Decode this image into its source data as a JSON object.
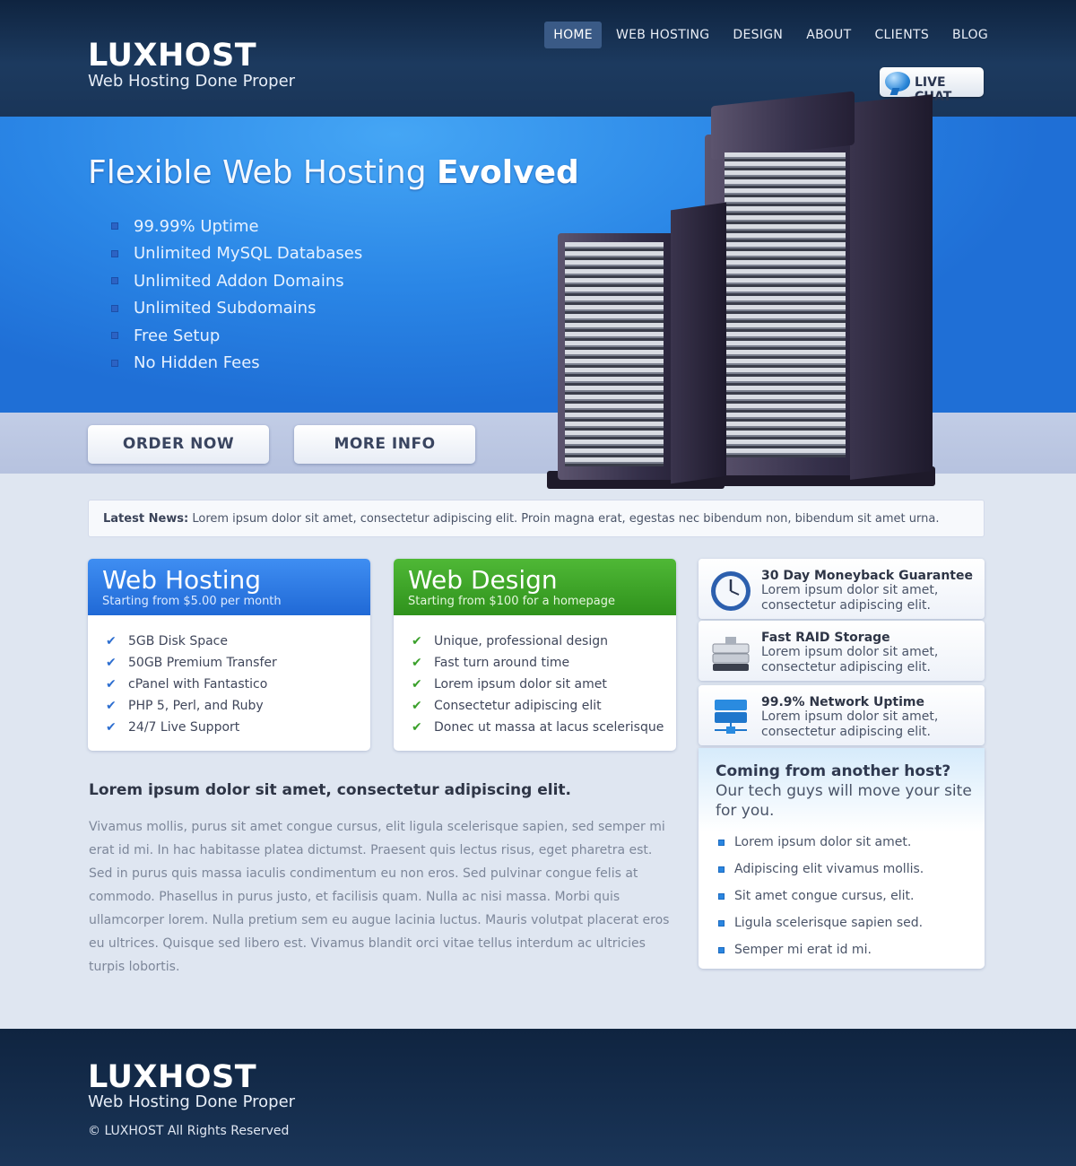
{
  "brand": {
    "name": "LUXHOST",
    "tagline": "Web Hosting Done Proper"
  },
  "nav": {
    "items": [
      "HOME",
      "WEB HOSTING",
      "DESIGN",
      "ABOUT",
      "CLIENTS",
      "BLOG"
    ],
    "active": "HOME"
  },
  "live_chat": {
    "label": "LIVE CHAT",
    "icon": "chat-bubble-icon"
  },
  "hero": {
    "title_plain": "Flexible Web Hosting",
    "title_bold": "Evolved",
    "features": [
      "99.99% Uptime",
      "Unlimited MySQL Databases",
      "Unlimited Addon Domains",
      "Unlimited Subdomains",
      "Free Setup",
      "No Hidden Fees"
    ],
    "order_label": "ORDER NOW",
    "more_label": "MORE INFO"
  },
  "news": {
    "label": "Latest News:",
    "text": "Lorem ipsum dolor sit amet, consectetur adipiscing elit. Proin magna erat, egestas nec bibendum non, bibendum sit amet urna."
  },
  "cards": {
    "hosting": {
      "title": "Web Hosting",
      "subtitle": "Starting from $5.00 per month",
      "items": [
        "5GB Disk Space",
        "50GB Premium Transfer",
        "cPanel with Fantastico",
        "PHP 5, Perl, and Ruby",
        "24/7 Live Support"
      ]
    },
    "design": {
      "title": "Web Design",
      "subtitle": "Starting from $100 for a homepage",
      "items": [
        "Unique, professional design",
        "Fast turn around time",
        "Lorem ipsum dolor sit amet",
        "Consectetur adipiscing elit",
        "Donec ut massa at lacus scelerisque"
      ]
    }
  },
  "side": {
    "items": [
      {
        "title": "30 Day Moneyback Guarantee",
        "text": "Lorem ipsum dolor sit amet, consectetur adipiscing elit.",
        "icon": "clock-icon"
      },
      {
        "title": "Fast RAID Storage",
        "text": "Lorem ipsum dolor sit amet, consectetur adipiscing elit.",
        "icon": "hard-drive-icon"
      },
      {
        "title": "99.9% Network Uptime",
        "text": "Lorem ipsum dolor sit amet, consectetur adipiscing elit.",
        "icon": "network-icon"
      }
    ]
  },
  "migrate": {
    "title": "Coming from another host?",
    "subtitle": "Our tech guys will move your site for you.",
    "items": [
      "Lorem ipsum dolor sit amet.",
      "Adipiscing elit vivamus mollis.",
      "Sit amet congue cursus, elit.",
      "Ligula scelerisque sapien sed.",
      "Semper mi erat id mi."
    ]
  },
  "article": {
    "title": "Lorem ipsum dolor sit amet, consectetur adipiscing elit.",
    "body": "Vivamus mollis, purus sit amet congue cursus, elit ligula scelerisque sapien, sed semper mi erat id mi. In hac habitasse platea dictumst. Praesent quis lectus risus, eget pharetra est. Sed in purus quis massa iaculis condimentum eu non eros. Sed pulvinar congue felis at commodo. Phasellus in purus justo, et facilisis quam. Nulla ac nisi massa. Morbi quis ullamcorper lorem. Nulla pretium sem eu augue lacinia luctus. Mauris volutpat placerat eros eu ultrices. Quisque sed libero est. Vivamus blandit orci vitae tellus interdum ac ultricies turpis lobortis."
  },
  "footer": {
    "name": "LUXHOST",
    "tagline": "Web Hosting Done Proper",
    "copyright": "© LUXHOST All Rights Reserved"
  },
  "colors": {
    "header_bg": "#1a3558",
    "hero_blue": "#2a86e6",
    "hosting_blue": "#2069d6",
    "design_green": "#3aa02a",
    "page_bg": "#dfe6f1"
  }
}
